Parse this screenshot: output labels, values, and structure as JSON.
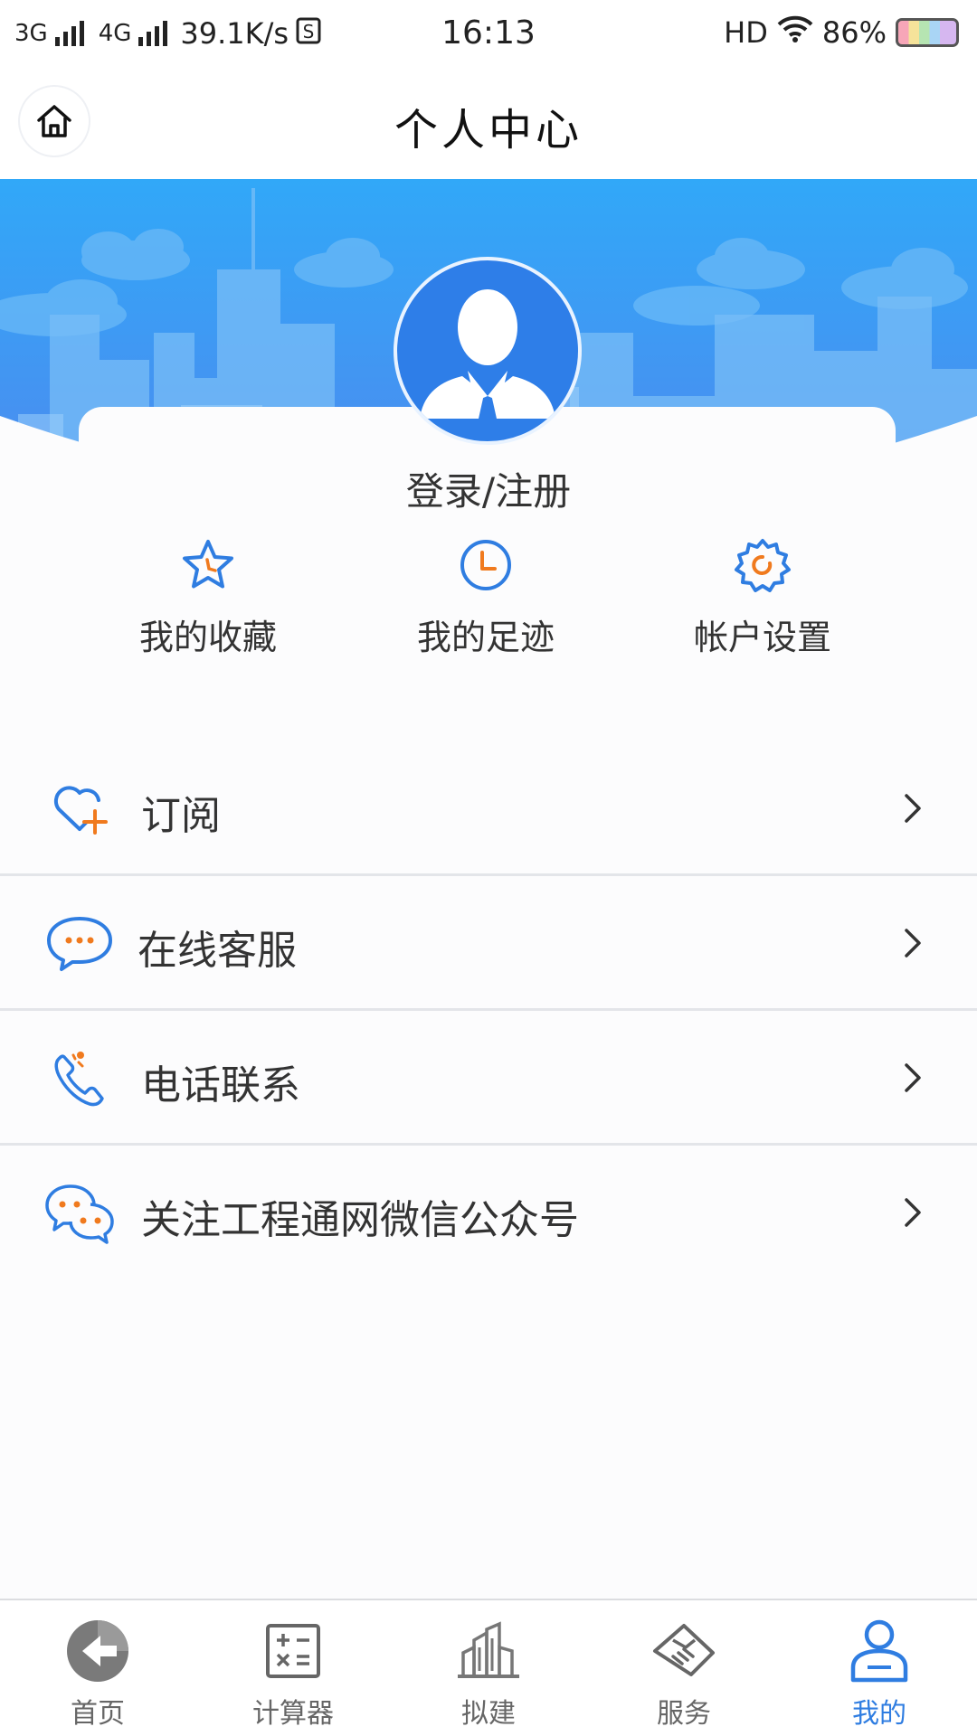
{
  "status_bar": {
    "network_1": "3G",
    "network_2": "4G",
    "speed": "39.1K/s",
    "time": "16:13",
    "hd": "HD",
    "battery": "86%"
  },
  "header": {
    "title": "个人中心"
  },
  "profile": {
    "login_label": "登录/注册"
  },
  "quick_actions": [
    {
      "label": "我的收藏",
      "icon": "star-icon"
    },
    {
      "label": "我的足迹",
      "icon": "clock-icon"
    },
    {
      "label": "帐户设置",
      "icon": "gear-icon"
    }
  ],
  "menu": [
    {
      "label": "订阅",
      "icon": "heart-plus-icon"
    },
    {
      "label": "在线客服",
      "icon": "chat-bubble-icon"
    },
    {
      "label": "电话联系",
      "icon": "phone-icon"
    },
    {
      "label": "关注工程通网微信公众号",
      "icon": "wechat-icon"
    }
  ],
  "bottom_nav": [
    {
      "label": "首页",
      "icon": "home-logo-icon",
      "active": false
    },
    {
      "label": "计算器",
      "icon": "calculator-icon",
      "active": false
    },
    {
      "label": "拟建",
      "icon": "buildings-icon",
      "active": false
    },
    {
      "label": "服务",
      "icon": "handshake-icon",
      "active": false
    },
    {
      "label": "我的",
      "icon": "user-icon",
      "active": true
    }
  ],
  "colors": {
    "accent": "#2f7de1",
    "orange": "#f07a1e",
    "banner_top": "#33a7f7",
    "banner_bottom": "#4a8ff0"
  }
}
